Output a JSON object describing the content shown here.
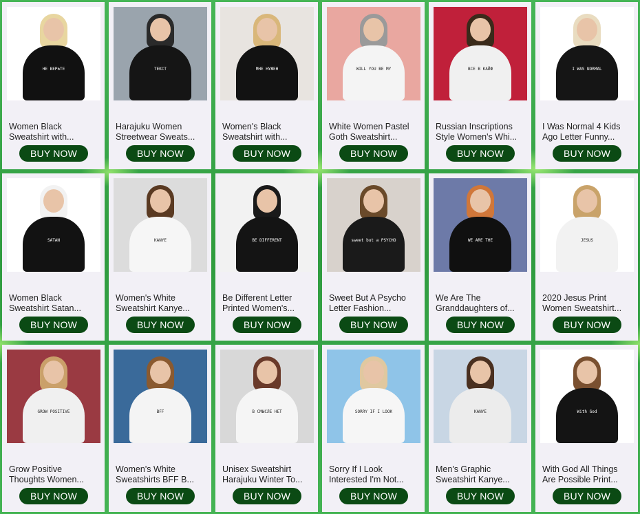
{
  "button_label": "BUY NOW",
  "products": [
    {
      "title_line1": "Women Black",
      "title_line2": "Sweatshirt with...",
      "shirt": "#111111",
      "hair": "#e8d6a0",
      "bg": "#ffffff",
      "print": "НЕ ВЕРЬТЕ"
    },
    {
      "title_line1": "Harajuku Women",
      "title_line2": "Streetwear Sweats...",
      "shirt": "#151515",
      "hair": "#2a2a2a",
      "bg": "#9aa4ad",
      "print": "ТЕКСТ"
    },
    {
      "title_line1": "Women's Black",
      "title_line2": "Sweatshirt with...",
      "shirt": "#121212",
      "hair": "#d9b77a",
      "bg": "#e8e4e0",
      "print": "МНЕ НУЖЕН"
    },
    {
      "title_line1": "White Women Pastel",
      "title_line2": "Goth Sweatshirt...",
      "shirt": "#f4f4f4",
      "hair": "#9a9a9a",
      "bg": "#e9a7a0",
      "print": "WILL YOU BE MY"
    },
    {
      "title_line1": "Russian Inscriptions",
      "title_line2": "Style Women's Whi...",
      "shirt": "#f0f0f0",
      "hair": "#3a2a1a",
      "bg": "#c0203a",
      "print": "ВСЕ В КАЙФ"
    },
    {
      "title_line1": "I Was Normal 4 Kids",
      "title_line2": "Ago Letter Funny...",
      "shirt": "#151515",
      "hair": "#e9dcc0",
      "bg": "#ffffff",
      "print": "I WAS NORMAL"
    },
    {
      "title_line1": "Women Black",
      "title_line2": "Sweatshirt Satan...",
      "shirt": "#121212",
      "hair": "#f2f2f2",
      "bg": "#ffffff",
      "print": "SATAN"
    },
    {
      "title_line1": "Women's White",
      "title_line2": "Sweatshirt Kanye...",
      "shirt": "#f6f6f6",
      "hair": "#5a3a22",
      "bg": "#dcdcdc",
      "print": "KANYE"
    },
    {
      "title_line1": "Be Different Letter",
      "title_line2": "Printed Women's...",
      "shirt": "#141414",
      "hair": "#1a1a1a",
      "bg": "#f2f2f2",
      "print": "BE DIFFERENT"
    },
    {
      "title_line1": "Sweet But A Psycho",
      "title_line2": "Letter Fashion...",
      "shirt": "#1a1a1a",
      "hair": "#6a4a2a",
      "bg": "#d8d2cc",
      "print": "sweet but a PSYCHO"
    },
    {
      "title_line1": "We Are The",
      "title_line2": "Granddaughters of...",
      "shirt": "#101010",
      "hair": "#d0773a",
      "bg": "#6d7aa8",
      "print": "WE ARE THE"
    },
    {
      "title_line1": "2020 Jesus Print",
      "title_line2": "Women Sweatshirt...",
      "shirt": "#f2f2f2",
      "hair": "#c9a36a",
      "bg": "#ffffff",
      "print": "JESUS"
    },
    {
      "title_line1": "Grow Positive",
      "title_line2": "Thoughts Women...",
      "shirt": "#f0f0f0",
      "hair": "#caa06a",
      "bg": "#9a3a42",
      "print": "GROW POSITIVE"
    },
    {
      "title_line1": "Women's White",
      "title_line2": "Sweatshirts BFF B...",
      "shirt": "#f4f4f4",
      "hair": "#8a5a30",
      "bg": "#3a6a9a",
      "print": "BFF"
    },
    {
      "title_line1": "Unisex Sweatshirt",
      "title_line2": "Harajuku Winter To...",
      "shirt": "#f5f5f5",
      "hair": "#6a3a2a",
      "bg": "#d8d8d8",
      "print": "В СМЫСЛЕ НЕТ"
    },
    {
      "title_line1": "Sorry If I Look",
      "title_line2": "Interested I'm Not...",
      "shirt": "#f6f6f6",
      "hair": "#e0c8a0",
      "bg": "#8fc4e8",
      "print": "SORRY IF I LOOK"
    },
    {
      "title_line1": "Men's Graphic",
      "title_line2": "Sweatshirt Kanye...",
      "shirt": "#ececec",
      "hair": "#4a3020",
      "bg": "#c8d6e4",
      "print": "KANYE"
    },
    {
      "title_line1": "With God All Things",
      "title_line2": "Are Possible Print...",
      "shirt": "#141414",
      "hair": "#7a5030",
      "bg": "#ffffff",
      "print": "With God"
    }
  ]
}
